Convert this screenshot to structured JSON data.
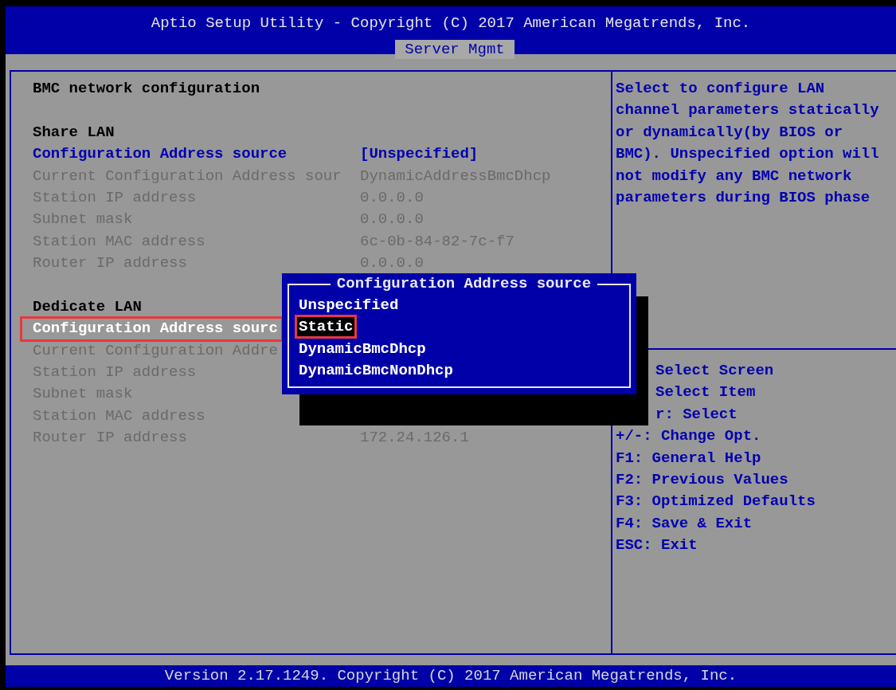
{
  "header": {
    "title": "Aptio Setup Utility - Copyright (C) 2017 American Megatrends, Inc.",
    "tabs": [
      {
        "label": "Server Mgmt",
        "selected": true
      }
    ]
  },
  "main": {
    "title": "BMC network configuration",
    "sections": [
      {
        "heading": "Share LAN",
        "items": [
          {
            "label": "Configuration Address source",
            "value": "[Unspecified]",
            "disabled": false,
            "selected": false,
            "highlighted": false
          },
          {
            "label": "Current Configuration Address sour",
            "value": "DynamicAddressBmcDhcp",
            "disabled": true,
            "selected": false,
            "highlighted": false
          },
          {
            "label": "Station IP address",
            "value": "0.0.0.0",
            "disabled": true,
            "selected": false,
            "highlighted": false
          },
          {
            "label": "Subnet mask",
            "value": "0.0.0.0",
            "disabled": true,
            "selected": false,
            "highlighted": false
          },
          {
            "label": "Station MAC address",
            "value": "6c-0b-84-82-7c-f7",
            "disabled": true,
            "selected": false,
            "highlighted": false
          },
          {
            "label": "Router IP address",
            "value": "0.0.0.0",
            "disabled": true,
            "selected": false,
            "highlighted": false
          }
        ]
      },
      {
        "heading": "Dedicate LAN",
        "items": [
          {
            "label": "Configuration Address sourc",
            "disabled": false,
            "selected": true,
            "highlighted": true
          },
          {
            "label": "Current Configuration Addre",
            "disabled": true,
            "selected": false,
            "highlighted": false
          },
          {
            "label": "Station IP address",
            "disabled": true,
            "selected": false,
            "highlighted": false
          },
          {
            "label": "Subnet mask",
            "disabled": true,
            "selected": false,
            "highlighted": false
          },
          {
            "label": "Station MAC address",
            "disabled": true,
            "selected": false,
            "highlighted": false
          },
          {
            "label": "Router IP address",
            "value": "172.24.126.1",
            "disabled": true,
            "selected": false,
            "highlighted": false
          }
        ]
      }
    ]
  },
  "popup": {
    "title": "Configuration Address source",
    "options": [
      {
        "label": "Unspecified",
        "selected": false,
        "highlighted": false
      },
      {
        "label": "Static",
        "selected": true,
        "highlighted": true
      },
      {
        "label": "DynamicBmcDhcp",
        "selected": false,
        "highlighted": false
      },
      {
        "label": "DynamicBmcNonDhcp",
        "selected": false,
        "highlighted": false
      }
    ]
  },
  "help_text": "Select to configure LAN\nchannel parameters statically\nor dynamically(by BIOS or\nBMC). Unspecified option will\nnot modify any BMC network\nparameters during BIOS phase",
  "help_keys": [
    {
      "text": "Select Screen",
      "obscured": true
    },
    {
      "text": "Select Item",
      "obscured": true
    },
    {
      "text": "r: Select",
      "obscured": true
    },
    {
      "text": "+/-: Change Opt.",
      "obscured": false
    },
    {
      "text": "F1: General Help",
      "obscured": false
    },
    {
      "text": "F2: Previous Values",
      "obscured": false
    },
    {
      "text": "F3: Optimized Defaults",
      "obscured": false
    },
    {
      "text": "F4: Save & Exit",
      "obscured": false
    },
    {
      "text": "ESC: Exit",
      "obscured": false
    }
  ],
  "footer": "Version 2.17.1249. Copyright (C) 2017 American Megatrends, Inc."
}
